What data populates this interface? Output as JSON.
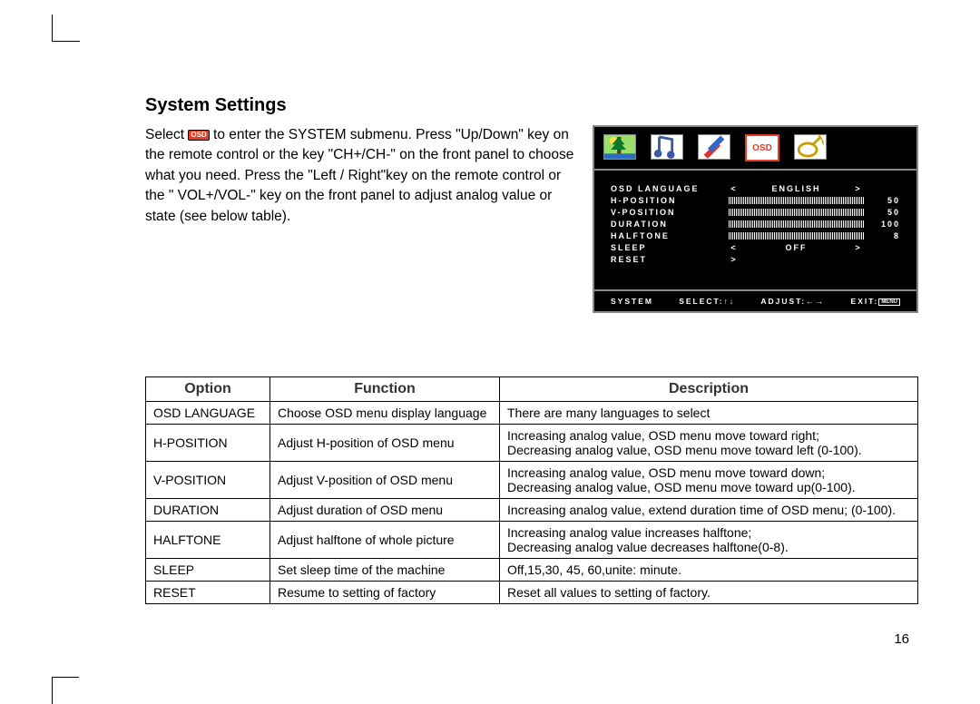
{
  "title": "System Settings",
  "intro_prefix": "Select ",
  "intro_suffix": " to enter the SYSTEM submenu. Press \"Up/Down\" key on the remote control or the key \"CH+/CH-\" on the front panel to choose what you need. Press the \"Left / Right\"key on the remote control or the \" VOL+/VOL-\" key on the front panel to adjust analog value or state (see below table).",
  "osd_badge": "OSD",
  "osd_menu": {
    "rows": [
      {
        "label": "OSD LANGUAGE",
        "type": "select",
        "value": "ENGLISH",
        "num": ""
      },
      {
        "label": "H-POSITION",
        "type": "bar",
        "value": "",
        "num": "50"
      },
      {
        "label": "V-POSITION",
        "type": "bar",
        "value": "",
        "num": "50"
      },
      {
        "label": "DURATION",
        "type": "bar",
        "value": "",
        "num": "100"
      },
      {
        "label": "HALFTONE",
        "type": "bar",
        "value": "",
        "num": "8"
      },
      {
        "label": "SLEEP",
        "type": "select",
        "value": "OFF",
        "num": ""
      },
      {
        "label": "RESET",
        "type": "arrow",
        "value": ">",
        "num": ""
      }
    ],
    "footer_system": "SYSTEM",
    "footer_select": "SELECT:↑↓",
    "footer_adjust": "ADJUST:←→",
    "footer_exit": "EXIT:",
    "footer_menu_chip": "MENU"
  },
  "table": {
    "headers": [
      "Option",
      "Function",
      "Description"
    ],
    "rows": [
      {
        "option": "OSD LANGUAGE",
        "function": "Choose OSD menu display language",
        "description": "There are many languages to select"
      },
      {
        "option": "H-POSITION",
        "function": "Adjust H-position of OSD menu",
        "description": "Increasing analog value, OSD menu move toward right;\nDecreasing analog value, OSD menu move toward left (0-100)."
      },
      {
        "option": "V-POSITION",
        "function": "Adjust V-position of OSD menu",
        "description": "Increasing analog value, OSD menu move toward down;\nDecreasing analog value, OSD menu move toward up(0-100)."
      },
      {
        "option": "DURATION",
        "function": "Adjust duration of OSD menu",
        "description": "Increasing analog value, extend duration time of OSD menu; (0-100)."
      },
      {
        "option": "HALFTONE",
        "function": "Adjust halftone of whole picture",
        "description": "Increasing analog value increases halftone;\nDecreasing analog value decreases halftone(0-8)."
      },
      {
        "option": "SLEEP",
        "function": "Set sleep time of the machine",
        "description": "Off,15,30, 45, 60,unite: minute."
      },
      {
        "option": "RESET",
        "function": "Resume to setting of factory",
        "description": "Reset all values to setting of factory."
      }
    ]
  },
  "page_number": "16"
}
